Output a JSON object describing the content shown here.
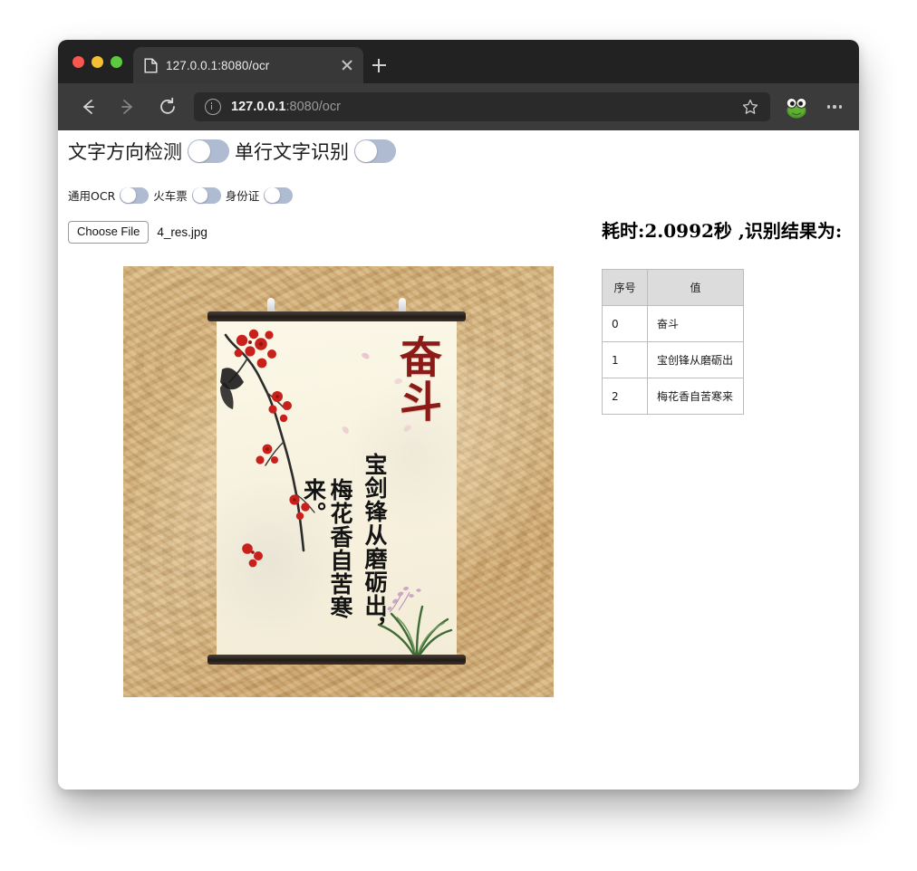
{
  "window": {
    "traffic_lights": [
      "close",
      "minimize",
      "maximize"
    ]
  },
  "tab": {
    "title": "127.0.0.1:8080/ocr",
    "favicon": "page-icon",
    "close": "close-icon",
    "new_tab": "plus-icon"
  },
  "toolbar": {
    "back": "back-arrow-icon",
    "forward": "forward-arrow-icon",
    "reload": "reload-icon",
    "site_info": "info-icon",
    "url_host": "127.0.0.1",
    "url_rest": ":8080/ocr",
    "bookmark": "star-icon",
    "extension": "frog-icon",
    "menu": "more-options-icon"
  },
  "page": {
    "toggles_primary": [
      {
        "label": "文字方向检测",
        "state": "off"
      },
      {
        "label": "单行文字识别",
        "state": "off"
      }
    ],
    "toggles_secondary": [
      {
        "label": "通用OCR",
        "state": "off"
      },
      {
        "label": "火车票",
        "state": "off"
      },
      {
        "label": "身份证",
        "state": "off"
      }
    ],
    "file_input": {
      "button_label": "Choose File",
      "file_name": "4_res.jpg"
    },
    "preview_image": {
      "alt": "中国风励志挂轴：奋斗 宝剑锋从磨砺出，梅花香自苦寒来。",
      "title_text": "奋斗",
      "column_right": "宝剑锋从磨砺出，",
      "column_left": "梅花香自苦寒来。"
    },
    "result": {
      "heading": "耗时:2.0992秒 ,识别结果为:",
      "columns": [
        "序号",
        "值"
      ],
      "rows": [
        {
          "index": "0",
          "value": "奋斗"
        },
        {
          "index": "1",
          "value": "宝创锋从磨砺出"
        },
        {
          "index": "2",
          "value": "梅花香自苦寒来"
        }
      ]
    }
  },
  "colors": {
    "tabbar": "#222222",
    "toolbar": "#3b3b3b",
    "omnibox": "#2a2a2a",
    "toggle_track": "#aebbd0",
    "table_header": "#dcdcdc",
    "table_border": "#bdbdbd"
  }
}
